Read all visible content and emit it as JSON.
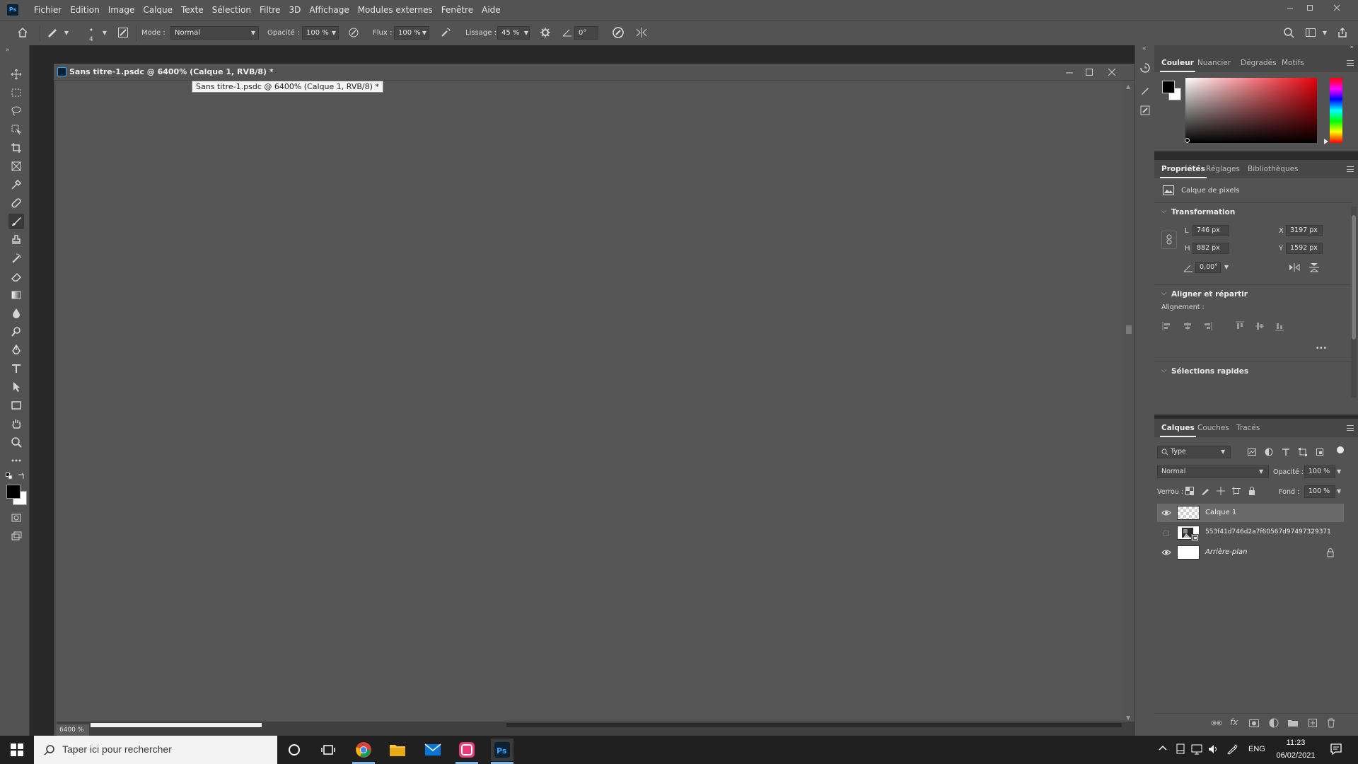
{
  "app": {
    "logo_text": "Ps"
  },
  "menu": {
    "items": [
      "Fichier",
      "Edition",
      "Image",
      "Calque",
      "Texte",
      "Sélection",
      "Filtre",
      "3D",
      "Affichage",
      "Modules externes",
      "Fenêtre",
      "Aide"
    ]
  },
  "options": {
    "brush_size": "4",
    "mode_label": "Mode :",
    "mode_value": "Normal",
    "opacity_label": "Opacité :",
    "opacity_value": "100 %",
    "flow_label": "Flux :",
    "flow_value": "100 %",
    "smoothing_label": "Lissage :",
    "smoothing_value": "45 %",
    "angle_value": "0°"
  },
  "document": {
    "title": "Sans titre-1.psdc @ 6400% (Calque 1, RVB/8) *",
    "tooltip": "Sans titre-1.psdc @ 6400% (Calque 1, RVB/8) *",
    "zoom": "6400 %"
  },
  "color_panel": {
    "tabs": [
      "Couleur",
      "Nuancier",
      "Dégradés",
      "Motifs"
    ],
    "foreground": "#000000",
    "background": "#ffffff",
    "hue_color": "#e8000c"
  },
  "properties_panel": {
    "tabs": [
      "Propriétés",
      "Réglages",
      "Bibliothèques"
    ],
    "layer_type": "Calque de pixels",
    "transform": {
      "title": "Transformation",
      "w_label": "L",
      "w_value": "746 px",
      "h_label": "H",
      "h_value": "882 px",
      "x_label": "X",
      "x_value": "3197 px",
      "y_label": "Y",
      "y_value": "1592 px",
      "angle_value": "0,00°"
    },
    "align": {
      "title": "Aligner et répartir",
      "sub_label": "Alignement :",
      "more": "•••"
    },
    "quick_actions": {
      "title": "Sélections rapides"
    }
  },
  "layers_panel": {
    "tabs": [
      "Calques",
      "Couches",
      "Tracés"
    ],
    "filter_value": "Type",
    "blend_mode": "Normal",
    "opacity_label": "Opacité :",
    "opacity_value": "100 %",
    "lock_label": "Verrou :",
    "fill_label": "Fond :",
    "fill_value": "100 %",
    "layers": [
      {
        "name": "Calque 1",
        "visible": true,
        "selected": true,
        "italic": false
      },
      {
        "name": "553f41d746d2a7f60567d97497329371",
        "visible": false,
        "selected": false,
        "italic": false
      },
      {
        "name": "Arrière-plan",
        "visible": true,
        "selected": false,
        "italic": true
      }
    ]
  },
  "taskbar": {
    "search_placeholder": "Taper ici pour rechercher",
    "lang": "ENG",
    "time": "11:23",
    "date": "06/02/2021"
  }
}
